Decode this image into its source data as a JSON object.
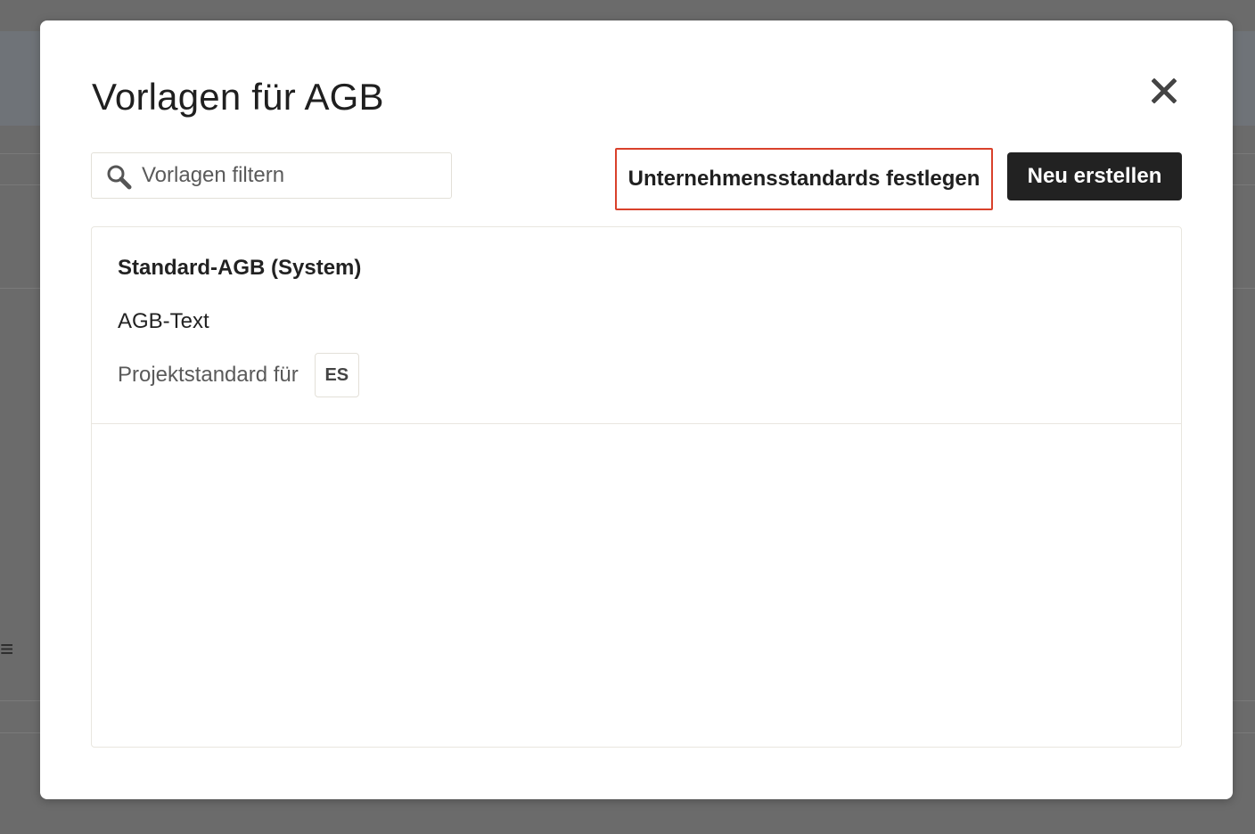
{
  "modal": {
    "title": "Vorlagen für AGB",
    "close_icon": "close-icon"
  },
  "search": {
    "placeholder": "Vorlagen filtern",
    "value": "",
    "icon": "search-icon"
  },
  "toolbar": {
    "company_defaults_label": "Unternehmensstandards festlegen",
    "create_new_label": "Neu erstellen"
  },
  "templates": [
    {
      "title": "Standard-AGB (System)",
      "subtitle": "AGB-Text",
      "default_label": "Projektstandard für",
      "language": "ES"
    }
  ],
  "colors": {
    "overlay": "#6b6b6b",
    "highlight_border": "#d9412b",
    "primary_button": "#222222"
  }
}
